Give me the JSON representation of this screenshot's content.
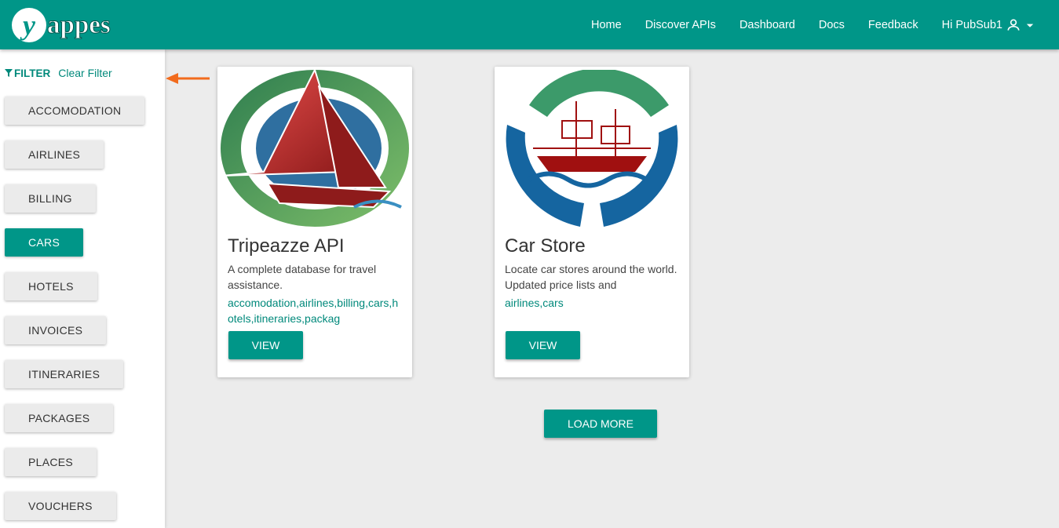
{
  "header": {
    "logo_text": "yappes",
    "nav": [
      "Home",
      "Discover APIs",
      "Dashboard",
      "Docs",
      "Feedback"
    ],
    "user_greeting": "Hi PubSub1"
  },
  "sidebar": {
    "filter_label": "FILTER",
    "clear_label": "Clear Filter",
    "categories": [
      {
        "label": "ACCOMODATION",
        "active": false
      },
      {
        "label": "AIRLINES",
        "active": false
      },
      {
        "label": "BILLING",
        "active": false
      },
      {
        "label": "CARS",
        "active": true
      },
      {
        "label": "HOTELS",
        "active": false
      },
      {
        "label": "INVOICES",
        "active": false
      },
      {
        "label": "ITINERARIES",
        "active": false
      },
      {
        "label": "PACKAGES",
        "active": false
      },
      {
        "label": "PLACES",
        "active": false
      },
      {
        "label": "VOUCHERS",
        "active": false
      }
    ]
  },
  "cards": [
    {
      "title": "Tripeazze API",
      "description": "A complete database for travel assistance.",
      "tags": "accomodation,airlines,billing,cars,hotels,itineraries,packag",
      "view_label": "VIEW",
      "image_icon": "sailboat-logo"
    },
    {
      "title": "Car Store",
      "description": "Locate car stores around the world. Updated price lists and",
      "tags": "airlines,cars",
      "view_label": "VIEW",
      "image_icon": "ship-logo"
    }
  ],
  "load_more_label": "LOAD MORE",
  "colors": {
    "primary": "#009688",
    "accent_text": "#00897b",
    "annotation_arrow": "#f26b1d"
  }
}
